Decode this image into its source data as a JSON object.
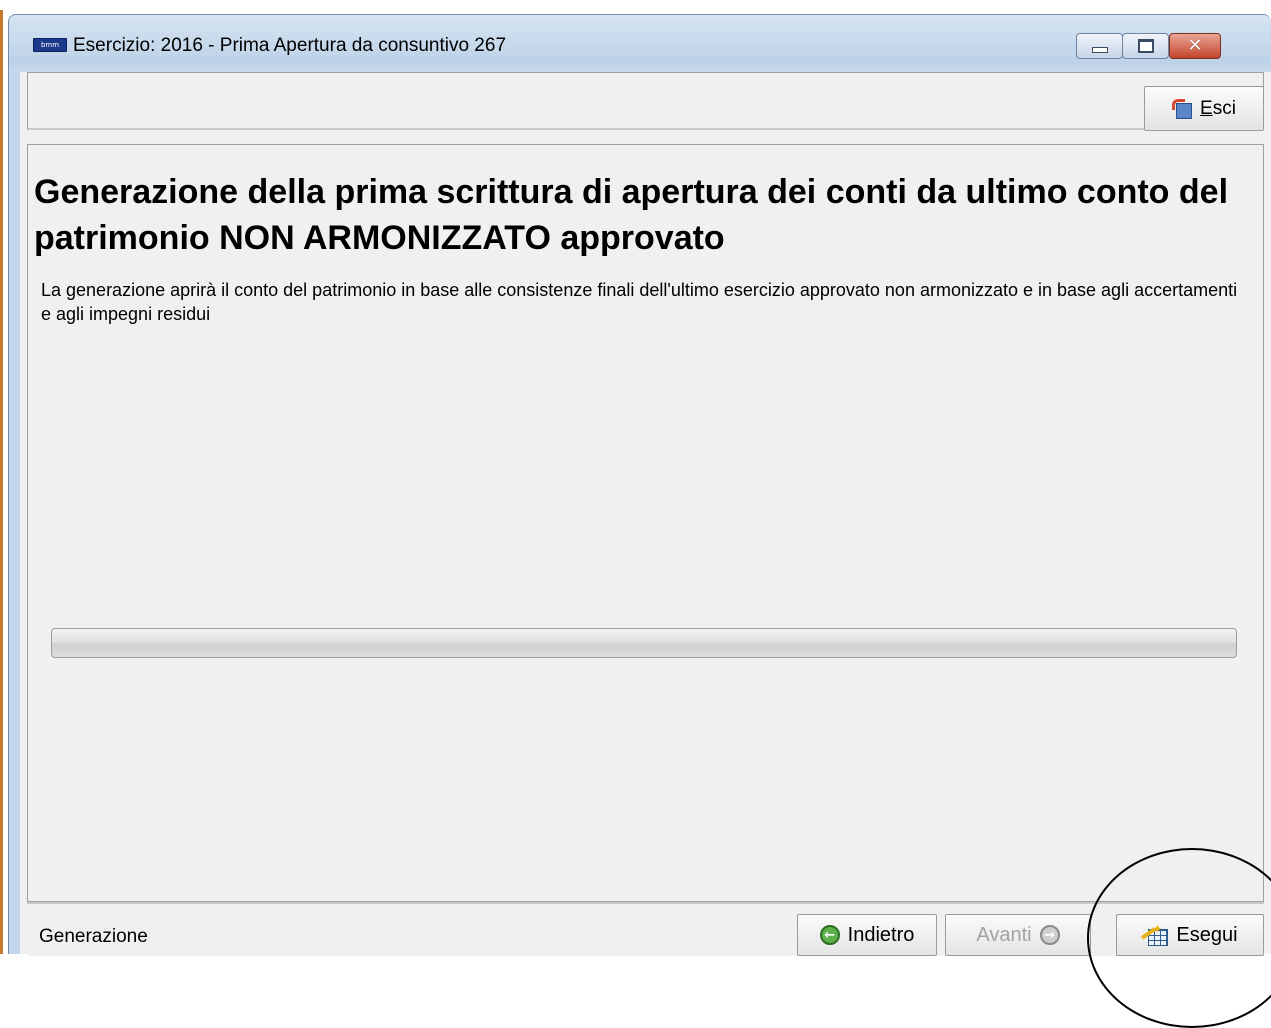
{
  "window": {
    "title": "Esercizio: 2016 - Prima Apertura da consuntivo 267",
    "app_icon_text": "bmm"
  },
  "toolbar": {
    "exit_label": "Esci"
  },
  "main": {
    "heading": "Generazione della prima scrittura di apertura dei conti da  ultimo conto del patrimonio NON ARMONIZZATO approvato",
    "description": "La generazione aprirà il conto del patrimonio in base alle consistenze finali dell'ultimo esercizio approvato non armonizzato e in base agli accertamenti e agli impegni residui",
    "progress_value": 0
  },
  "footer": {
    "status": "Generazione",
    "back_label": "Indietro",
    "next_label": "Avanti",
    "run_label": "Esegui"
  },
  "colors": {
    "window_frame": "#c3d6ea",
    "background": "#f0f0f0",
    "close_button": "#c4432b"
  }
}
